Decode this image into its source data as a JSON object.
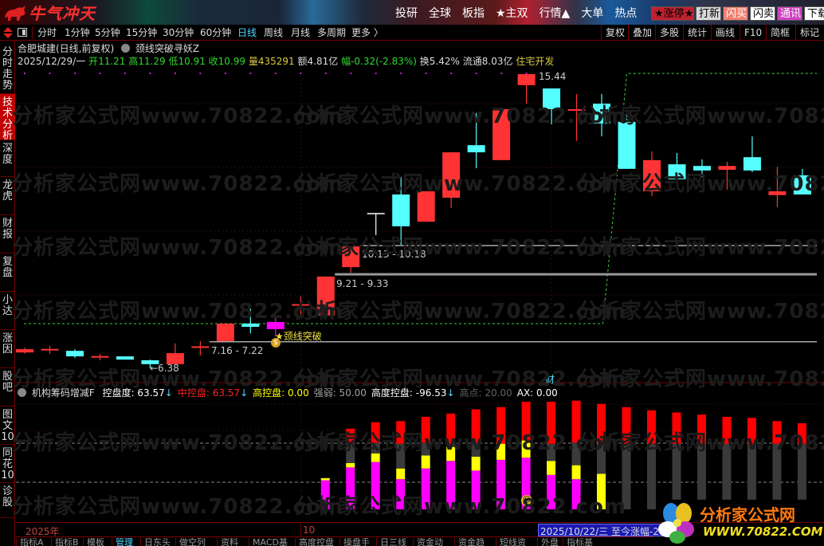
{
  "app": {
    "logo_text": "牛气冲天"
  },
  "topnav": [
    "投研",
    "全球",
    "板指",
    "★主双",
    "行情▲",
    "大单",
    "热点"
  ],
  "quick_buttons": [
    {
      "label": "★涨停★",
      "bg": "#c02030",
      "fg": "#000"
    },
    {
      "label": "打新",
      "bg": "#d8d8d8",
      "fg": "#000"
    },
    {
      "label": "闪买",
      "bg": "#f08070",
      "fg": "#fff"
    },
    {
      "label": "闪卖",
      "bg": "#ffffff",
      "fg": "#000"
    },
    {
      "label": "通讯",
      "bg": "#d040c0",
      "fg": "#fff"
    },
    {
      "label": "下载",
      "bg": "#ffffff",
      "fg": "#000"
    }
  ],
  "periods": [
    "分时",
    "1分钟",
    "5分钟",
    "15分钟",
    "30分钟",
    "60分钟",
    "日线",
    "周线",
    "月线",
    "多周期",
    "更多 〉"
  ],
  "active_period": "日线",
  "tools": [
    "复权",
    "叠加",
    "多股",
    "统计",
    "画线",
    "F10",
    "简框",
    "标记"
  ],
  "sidebar": [
    "分时走势",
    "技术分析",
    "深度",
    "龙虎",
    "财报",
    "复盘",
    "小达",
    "涨因",
    "股吧",
    "图文10",
    "同花10",
    "诊股"
  ],
  "sidebar_active": "技术分析",
  "stock": {
    "title": "合肥城建(日线,前复权)",
    "formula": "颈线突破寻妖Z",
    "date": "2025/12/29/一",
    "open_label": "开",
    "open": "11.21",
    "high_label": "高",
    "high": "11.29",
    "low_label": "低",
    "low": "10.91",
    "close_label": "收",
    "close": "10.99",
    "vol_label": "量",
    "vol": "435291",
    "amount": "额4.81亿",
    "chg_label": "幅",
    "chg": "-0.32(-2.83%)",
    "turnover": "换5.42%",
    "float": "流通8.03亿",
    "sector": "住宅开发"
  },
  "annotations": {
    "high": "15.44",
    "low": "←6.38",
    "zone1": "7.16 - 7.22",
    "zone2": "9.21 - 9.33",
    "zone3": "10.13 - 10.18",
    "breakout": "★颈线突破",
    "cai": "财"
  },
  "watermark": "分析家公式网www.70822.com",
  "indicator": {
    "name": "机构筹码增减F",
    "items": [
      {
        "label": "控盘度: 63.57",
        "color": "#ffffff",
        "arrow": "↓"
      },
      {
        "label": "中控盘: 63.57",
        "color": "#ff2020",
        "arrow": "↓"
      },
      {
        "label": "高控盘: 0.00",
        "color": "#ffff00",
        "arrow": ""
      },
      {
        "label": "强弱: 50.00",
        "color": "#a0a0a0",
        "arrow": ""
      },
      {
        "label": "高度控盘: -96.53",
        "color": "#ffffff",
        "arrow": "↓"
      },
      {
        "label": "高点: 20.00",
        "color": "#606060",
        "arrow": ""
      },
      {
        "label": "AX: 0.00",
        "color": "#ffffff",
        "arrow": ""
      }
    ]
  },
  "axis": {
    "year": "2025年",
    "month": "10",
    "cursor_info": "2025/10/22/三  至今涨幅-2"
  },
  "bottom_tabs": [
    "指标A",
    "指标B",
    "模板",
    "管理",
    "日东头",
    "做空列",
    "资料",
    "MACD基本",
    "高度控盘",
    "操盘手",
    "日三线",
    "资金动能",
    "资金趋势",
    "短线资金",
    "外盘",
    "指标基础"
  ],
  "bottom_active": "管理",
  "brand": {
    "name": "分析家公式网",
    "url": "WWW.70822.COM"
  },
  "colors": {
    "up": "#ff3333",
    "down": "#55ffff",
    "doji": "#ffffff",
    "special": "#ff00ff"
  },
  "chart_data": {
    "type": "candlestick",
    "candles": [
      [
        6.86,
        7.01,
        6.82,
        6.96,
        "up"
      ],
      [
        6.96,
        7.06,
        6.82,
        6.97,
        "up"
      ],
      [
        6.91,
        6.96,
        6.69,
        6.74,
        "down"
      ],
      [
        6.74,
        6.82,
        6.62,
        6.75,
        "up"
      ],
      [
        6.74,
        6.74,
        6.64,
        6.64,
        "down"
      ],
      [
        6.62,
        6.64,
        6.38,
        6.5,
        "down"
      ],
      [
        6.5,
        7.14,
        6.5,
        6.84,
        "up"
      ],
      [
        7.04,
        7.21,
        6.77,
        7.05,
        "up"
      ],
      [
        7.21,
        7.75,
        7.21,
        7.75,
        "up"
      ],
      [
        7.75,
        8.22,
        7.45,
        7.65,
        "down"
      ],
      [
        7.58,
        7.97,
        7.36,
        7.8,
        "special"
      ],
      [
        8.32,
        8.59,
        8.02,
        8.35,
        "up"
      ],
      [
        8.0,
        9.2,
        7.95,
        9.2,
        "up"
      ],
      [
        9.49,
        10.13,
        9.32,
        10.13,
        "up"
      ],
      [
        11.14,
        11.14,
        10.48,
        11.14,
        "doji"
      ],
      [
        11.73,
        12.27,
        10.18,
        10.75,
        "down"
      ],
      [
        10.89,
        11.83,
        10.89,
        11.83,
        "up"
      ],
      [
        11.63,
        13.03,
        11.31,
        13.03,
        "up"
      ],
      [
        13.25,
        14.24,
        12.54,
        13.03,
        "down"
      ],
      [
        12.79,
        14.36,
        12.79,
        14.36,
        "up"
      ],
      [
        15.1,
        15.44,
        14.53,
        15.44,
        "up"
      ],
      [
        15.0,
        15.0,
        13.89,
        14.36,
        "down"
      ],
      [
        14.31,
        14.83,
        13.38,
        14.36,
        "up"
      ],
      [
        14.53,
        14.83,
        13.52,
        13.92,
        "down"
      ],
      [
        13.97,
        14.19,
        12.52,
        12.52,
        "down"
      ],
      [
        11.83,
        13.06,
        11.68,
        12.79,
        "up"
      ],
      [
        12.66,
        13.01,
        12.0,
        12.2,
        "down"
      ],
      [
        12.61,
        12.81,
        12.27,
        12.47,
        "down"
      ],
      [
        12.49,
        12.74,
        11.88,
        12.61,
        "up"
      ],
      [
        12.88,
        13.52,
        12.42,
        12.47,
        "down"
      ],
      [
        11.71,
        12.59,
        11.34,
        11.83,
        "up"
      ],
      [
        12.32,
        12.52,
        11.73,
        11.73,
        "down"
      ]
    ],
    "levels": [
      {
        "low": 7.16,
        "high": 7.22,
        "from": 8
      },
      {
        "low": 9.21,
        "high": 9.33,
        "from": 13
      },
      {
        "low": 10.13,
        "high": 10.18,
        "from": 14
      }
    ],
    "neckline": {
      "before": 7.75,
      "after": 15.46,
      "switch_index": 24
    },
    "indicator_bars": {
      "start_index": 12,
      "bars": [
        {
          "base": 0,
          "magenta": 27,
          "yellow": 2,
          "gray": 0,
          "red": 0
        },
        {
          "base": 0,
          "magenta": 39,
          "yellow": 4,
          "gray": 19,
          "red": 13
        },
        {
          "base": 0,
          "magenta": 44,
          "yellow": 8,
          "gray": 10,
          "red": 19
        },
        {
          "base": 0,
          "magenta": 28,
          "yellow": 10,
          "gray": 23,
          "red": 21
        },
        {
          "base": 0,
          "magenta": 38,
          "yellow": 12,
          "gray": 12,
          "red": 24
        },
        {
          "base": 0,
          "magenta": 45,
          "yellow": 13,
          "gray": 3,
          "red": 28
        },
        {
          "base": 0,
          "magenta": 36,
          "yellow": 13,
          "gray": 13,
          "red": 31
        },
        {
          "base": 0,
          "magenta": 46,
          "yellow": 15,
          "gray": 0,
          "red": 34
        },
        {
          "base": 0,
          "magenta": 48,
          "yellow": 16,
          "gray": 0,
          "red": 36
        },
        {
          "base": 0,
          "magenta": 32,
          "yellow": 13,
          "gray": 16,
          "red": 39
        },
        {
          "base": 0,
          "magenta": 28,
          "yellow": 13,
          "gray": 21,
          "red": 39
        },
        {
          "base": 0,
          "magenta": 0,
          "yellow": 33,
          "gray": 28,
          "red": 37
        },
        {
          "base": 0,
          "magenta": 0,
          "yellow": 0,
          "gray": 61,
          "red": 34
        },
        {
          "base": 0,
          "magenta": 0,
          "yellow": 0,
          "gray": 61,
          "red": 31
        },
        {
          "base": 9,
          "magenta": 0,
          "yellow": 0,
          "gray": 52,
          "red": 29
        },
        {
          "base": 9,
          "magenta": 0,
          "yellow": 0,
          "gray": 52,
          "red": 27
        },
        {
          "base": 9,
          "magenta": 0,
          "yellow": 0,
          "gray": 52,
          "red": 25
        },
        {
          "base": 9,
          "magenta": 0,
          "yellow": 0,
          "gray": 52,
          "red": 24
        },
        {
          "base": 9,
          "magenta": 0,
          "yellow": 0,
          "gray": 52,
          "red": 21
        },
        {
          "base": 9,
          "magenta": 0,
          "yellow": 0,
          "gray": 52,
          "red": 19
        }
      ]
    }
  }
}
